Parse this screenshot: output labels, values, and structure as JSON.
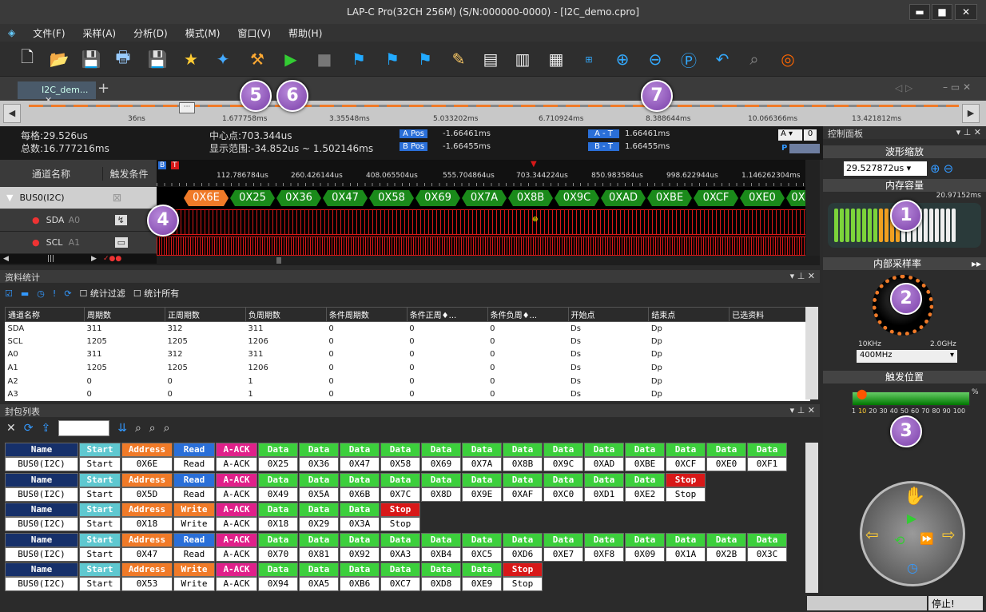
{
  "window": {
    "title": "LAP-C Pro(32CH 256M) (S/N:000000-0000) - [I2C_demo.cpro]",
    "min": "▬",
    "max": "■",
    "close": "✕"
  },
  "menu": [
    "文件(F)",
    "采样(A)",
    "分析(D)",
    "模式(M)",
    "窗口(V)",
    "帮助(H)"
  ],
  "tab": {
    "label": "I2C_dem...",
    "close": "✕",
    "add": "+"
  },
  "overview": {
    "ticks": [
      "36ns",
      "1.677758ms",
      "3.35548ms",
      "5.033202ms",
      "6.710924ms",
      "8.388644ms",
      "10.066366ms",
      "13.421812ms"
    ]
  },
  "info": {
    "per_div": "每格:29.526us",
    "total": "总数:16.777216ms",
    "center": "中心点:703.344us",
    "range": "显示范围:-34.852us ~ 1.502146ms",
    "apos_label": "A Pos",
    "apos": "-1.66461ms",
    "bpos_label": "B Pos",
    "bpos": "-1.66455ms",
    "at_label": "A - T",
    "at": "1.66461ms",
    "bt_label": "B - T",
    "bt": "1.66455ms",
    "a_sel": "A",
    "a_val": "0",
    "p": "P"
  },
  "channels": {
    "header_name": "通道名称",
    "header_trig": "触发条件",
    "items": [
      {
        "name": "BUS0(I2C)",
        "tag": ""
      },
      {
        "name": "SDA",
        "tag": "A0"
      },
      {
        "name": "SCL",
        "tag": "A1"
      }
    ]
  },
  "wave": {
    "ticks": [
      "112.786784us",
      "260.426144us",
      "408.065504us",
      "555.704864us",
      "703.344224us",
      "850.983584us",
      "998.622944us",
      "1.146262304ms"
    ],
    "packets": [
      "0X6E",
      "0X25",
      "0X36",
      "0X47",
      "0X58",
      "0X69",
      "0X7A",
      "0X8B",
      "0X9C",
      "0XAD",
      "0XBE",
      "0XCF",
      "0XE0",
      "0X"
    ],
    "cursor_label": "T"
  },
  "stats": {
    "title": "资料统计",
    "filter": "统计过滤",
    "all": "统计所有",
    "columns": [
      "通道名称",
      "周期数",
      "正周期数",
      "负周期数",
      "条件周期数",
      "条件正周♦...",
      "条件负周♦...",
      "开始点",
      "结束点",
      "已选资料"
    ],
    "rows": [
      [
        "SDA",
        "311",
        "312",
        "311",
        "0",
        "0",
        "0",
        "Ds",
        "Dp",
        ""
      ],
      [
        "SCL",
        "1205",
        "1205",
        "1206",
        "0",
        "0",
        "0",
        "Ds",
        "Dp",
        ""
      ],
      [
        "A0",
        "311",
        "312",
        "311",
        "0",
        "0",
        "0",
        "Ds",
        "Dp",
        ""
      ],
      [
        "A1",
        "1205",
        "1205",
        "1206",
        "0",
        "0",
        "0",
        "Ds",
        "Dp",
        ""
      ],
      [
        "A2",
        "0",
        "0",
        "1",
        "0",
        "0",
        "0",
        "Ds",
        "Dp",
        ""
      ],
      [
        "A3",
        "0",
        "0",
        "1",
        "0",
        "0",
        "0",
        "Ds",
        "Dp",
        ""
      ]
    ]
  },
  "packets": {
    "title": "封包列表",
    "rows": [
      {
        "h": [
          "Name",
          "Start",
          "Address",
          "Read",
          "A-ACK",
          "Data",
          "Data",
          "Data",
          "Data",
          "Data",
          "Data",
          "Data",
          "Data",
          "Data",
          "Data",
          "Data",
          "Data",
          "Data"
        ],
        "v": [
          "BUS0(I2C)",
          "Start",
          "0X6E",
          "Read",
          "A-ACK",
          "0X25",
          "0X36",
          "0X47",
          "0X58",
          "0X69",
          "0X7A",
          "0X8B",
          "0X9C",
          "0XAD",
          "0XBE",
          "0XCF",
          "0XE0",
          "0XF1"
        ]
      },
      {
        "h": [
          "Name",
          "Start",
          "Address",
          "Read",
          "A-ACK",
          "Data",
          "Data",
          "Data",
          "Data",
          "Data",
          "Data",
          "Data",
          "Data",
          "Data",
          "Data",
          "Stop"
        ],
        "v": [
          "BUS0(I2C)",
          "Start",
          "0X5D",
          "Read",
          "A-ACK",
          "0X49",
          "0X5A",
          "0X6B",
          "0X7C",
          "0X8D",
          "0X9E",
          "0XAF",
          "0XC0",
          "0XD1",
          "0XE2",
          "Stop"
        ]
      },
      {
        "h": [
          "Name",
          "Start",
          "Address",
          "Write",
          "A-ACK",
          "Data",
          "Data",
          "Data",
          "Stop"
        ],
        "v": [
          "BUS0(I2C)",
          "Start",
          "0X18",
          "Write",
          "A-ACK",
          "0X18",
          "0X29",
          "0X3A",
          "Stop"
        ]
      },
      {
        "h": [
          "Name",
          "Start",
          "Address",
          "Read",
          "A-ACK",
          "Data",
          "Data",
          "Data",
          "Data",
          "Data",
          "Data",
          "Data",
          "Data",
          "Data",
          "Data",
          "Data",
          "Data",
          "Data"
        ],
        "v": [
          "BUS0(I2C)",
          "Start",
          "0X47",
          "Read",
          "A-ACK",
          "0X70",
          "0X81",
          "0X92",
          "0XA3",
          "0XB4",
          "0XC5",
          "0XD6",
          "0XE7",
          "0XF8",
          "0X09",
          "0X1A",
          "0X2B",
          "0X3C"
        ]
      },
      {
        "h": [
          "Name",
          "Start",
          "Address",
          "Write",
          "A-ACK",
          "Data",
          "Data",
          "Data",
          "Data",
          "Data",
          "Data",
          "Stop"
        ],
        "v": [
          "BUS0(I2C)",
          "Start",
          "0X53",
          "Write",
          "A-ACK",
          "0X94",
          "0XA5",
          "0XB6",
          "0XC7",
          "0XD8",
          "0XE9",
          "Stop"
        ]
      }
    ]
  },
  "control": {
    "title": "控制面板",
    "zoom_title": "波形缩放",
    "zoom_value": "29.527872us",
    "mem_title": "内存容量",
    "mem_value": "20.97152ms",
    "rate_title": "内部采样率",
    "rate_min": "10KHz",
    "rate_max": "2.0GHz",
    "rate_value": "400MHz",
    "trig_title": "触发位置",
    "trig_pct": "%",
    "trig_scale": [
      "1",
      "10",
      "20",
      "30",
      "40",
      "50",
      "60",
      "70",
      "80",
      "90",
      "100"
    ]
  },
  "badges": [
    "1",
    "2",
    "3",
    "4",
    "5",
    "6",
    "7"
  ],
  "status": {
    "text": "停止!"
  },
  "colors": {
    "start": "#5fc8d0",
    "address": "#f07a28",
    "read": "#2a6fd8",
    "write": "#f07a28",
    "ack": "#e0208a",
    "data": "#3ccf3c",
    "stop": "#d81818",
    "name": "#16306a"
  }
}
